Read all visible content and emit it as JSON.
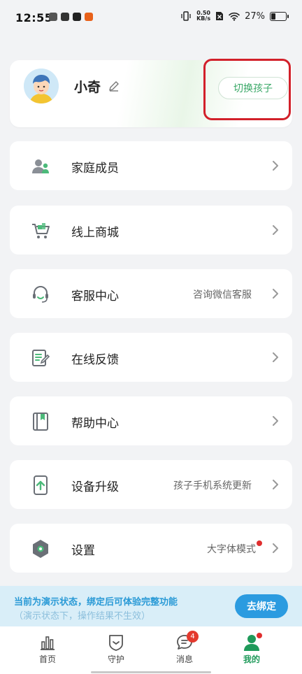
{
  "status_bar": {
    "time": "12:55",
    "network_speed_value": "0.50",
    "network_speed_unit": "KB/s",
    "battery": "27%",
    "battery_level": 0.27
  },
  "profile": {
    "child_name": "小奇",
    "switch_label": "切换孩子"
  },
  "menu": [
    {
      "label": "家庭成员",
      "hint": "",
      "icon": "family-members-icon"
    },
    {
      "label": "线上商城",
      "hint": "",
      "icon": "shopping-cart-icon"
    },
    {
      "label": "客服中心",
      "hint": "咨询微信客服",
      "icon": "headset-icon"
    },
    {
      "label": "在线反馈",
      "hint": "",
      "icon": "feedback-edit-icon"
    },
    {
      "label": "帮助中心",
      "hint": "",
      "icon": "help-book-icon"
    },
    {
      "label": "设备升级",
      "hint": "孩子手机系统更新",
      "icon": "device-upgrade-icon"
    },
    {
      "label": "设置",
      "hint": "大字体模式",
      "icon": "settings-gear-icon"
    }
  ],
  "demo_banner": {
    "line1": "当前为演示状态，绑定后可体验完整功能",
    "line2": "（演示状态下，操作结果不生效）",
    "bind_label": "去绑定"
  },
  "bottom_nav": {
    "tabs": [
      {
        "label": "首页",
        "icon": "bar-chart-icon"
      },
      {
        "label": "守护",
        "icon": "shield-icon"
      },
      {
        "label": "消息",
        "icon": "message-icon",
        "badge": "4"
      },
      {
        "label": "我的",
        "icon": "profile-person-icon",
        "active": true
      }
    ]
  },
  "colors": {
    "accent_green": "#3aa867",
    "accent_blue": "#2b9be0",
    "alert_red": "#e02e2e"
  }
}
